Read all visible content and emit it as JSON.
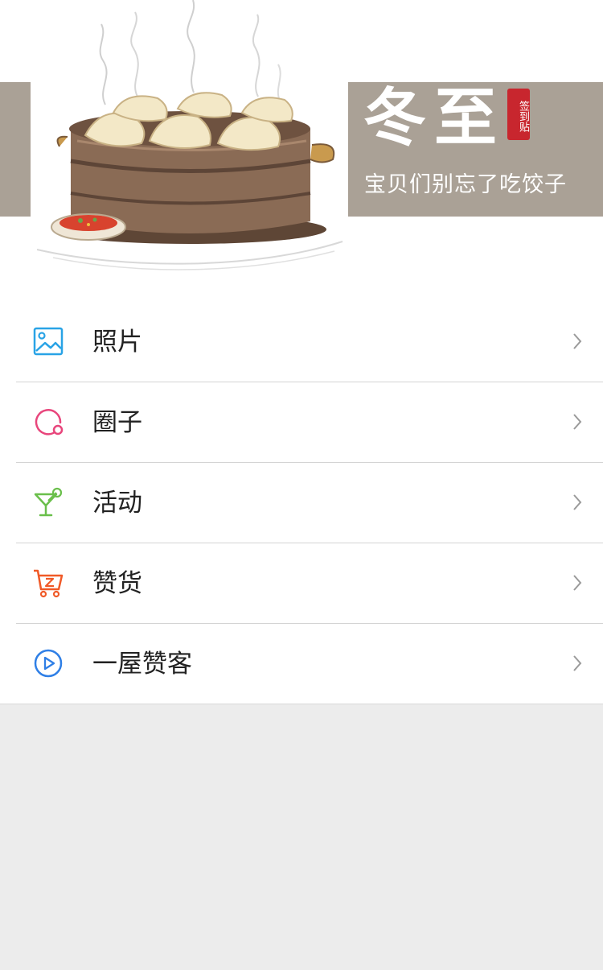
{
  "banner": {
    "title": "冬至",
    "stamp": "签到贴",
    "subtitle": "宝贝们别忘了吃饺子"
  },
  "menu": {
    "items": [
      {
        "label": "照片",
        "icon": "photo-icon",
        "color": "#29a3e6"
      },
      {
        "label": "圈子",
        "icon": "circle-icon",
        "color": "#e8467c"
      },
      {
        "label": "活动",
        "icon": "cocktail-icon",
        "color": "#6abf4b"
      },
      {
        "label": "赞货",
        "icon": "cart-icon",
        "color": "#f05a28"
      },
      {
        "label": "一屋赞客",
        "icon": "play-icon",
        "color": "#2f7fe6"
      }
    ]
  },
  "colors": {
    "background": "#ececec",
    "banner_strip": "#aaa196",
    "stamp": "#c8262e"
  }
}
